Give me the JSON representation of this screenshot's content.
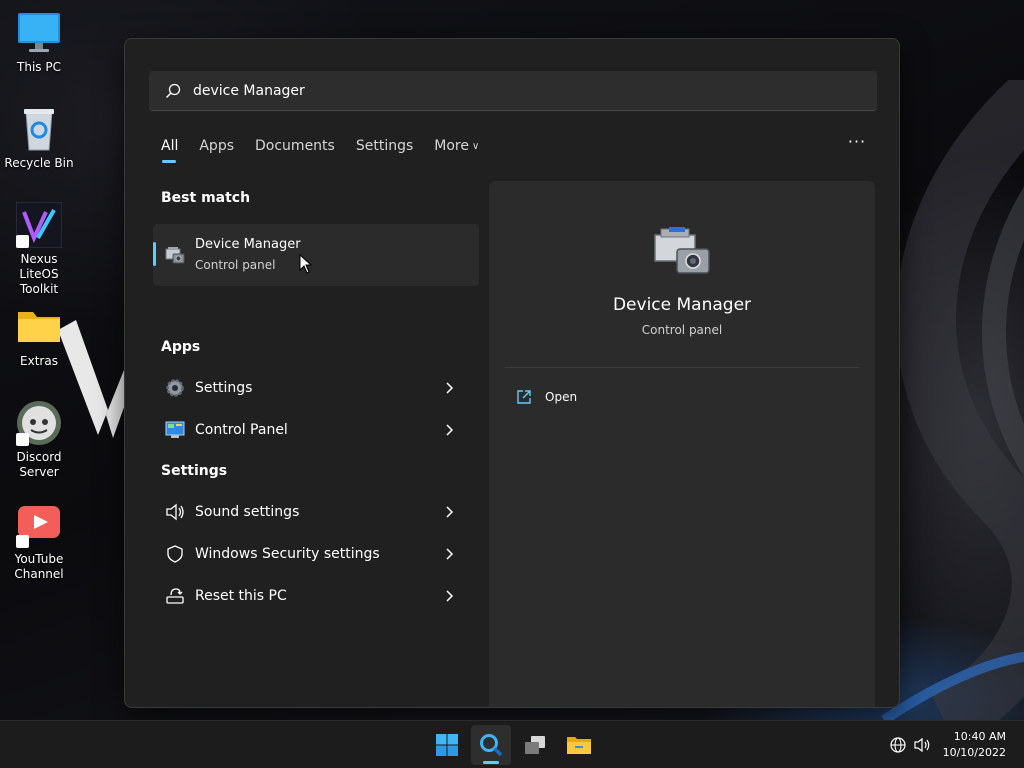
{
  "desktop": {
    "icons": [
      {
        "label": "This PC",
        "icon": "monitor-icon"
      },
      {
        "label": "Recycle Bin",
        "icon": "recycle-bin-icon"
      },
      {
        "label": "Nexus LiteOS\nToolkit",
        "icon": "nexus-toolkit-icon"
      },
      {
        "label": "Extras",
        "icon": "folder-icon"
      },
      {
        "label": "Discord\nServer",
        "icon": "discord-icon"
      },
      {
        "label": "YouTube\nChannel",
        "icon": "youtube-icon"
      }
    ]
  },
  "search": {
    "query": "device Manager",
    "tabs": [
      {
        "label": "All",
        "active": true
      },
      {
        "label": "Apps"
      },
      {
        "label": "Documents"
      },
      {
        "label": "Settings"
      },
      {
        "label": "More"
      }
    ],
    "more_options_label": "···"
  },
  "results": {
    "best_match_title": "Best match",
    "best_match": {
      "name": "Device Manager",
      "category": "Control panel",
      "icon": "device-manager-icon"
    },
    "apps_title": "Apps",
    "apps": [
      {
        "name": "Settings",
        "icon": "gear-icon"
      },
      {
        "name": "Control Panel",
        "icon": "control-panel-icon"
      }
    ],
    "settings_title": "Settings",
    "settings": [
      {
        "name": "Sound settings",
        "icon": "speaker-icon"
      },
      {
        "name": "Windows Security settings",
        "icon": "shield-icon"
      },
      {
        "name": "Reset this PC",
        "icon": "reset-pc-icon"
      }
    ]
  },
  "preview": {
    "title": "Device Manager",
    "subtitle": "Control panel",
    "actions": [
      {
        "label": "Open",
        "icon": "open-external-icon"
      }
    ]
  },
  "taskbar": {
    "buttons": [
      "start-icon",
      "search-icon",
      "task-view-icon",
      "file-explorer-icon"
    ],
    "active": "search-icon",
    "clock_time": "10:40 AM",
    "clock_date": "10/10/2022"
  },
  "colors": {
    "accent": "#60cdff",
    "panel_bg": "#202020",
    "item_bg": "#2b2b2b"
  }
}
